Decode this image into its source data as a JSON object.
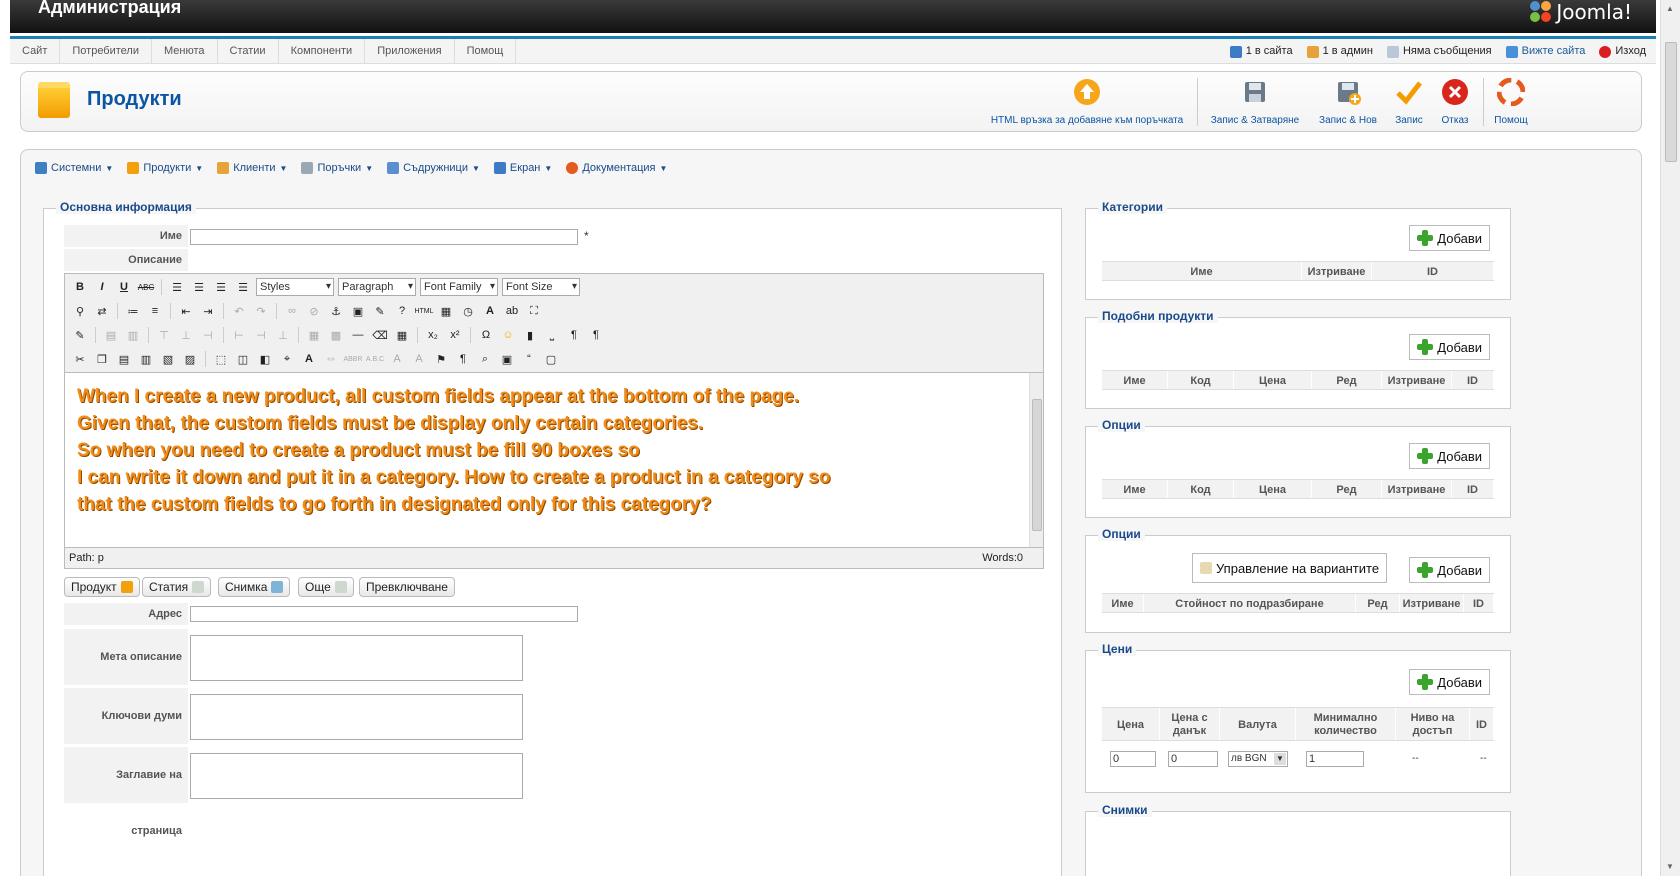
{
  "header": {
    "title": "Администрация",
    "logo": "Joomla!"
  },
  "menu": [
    "Сайт",
    "Потребители",
    "Менюта",
    "Статии",
    "Компоненти",
    "Приложения",
    "Помощ"
  ],
  "status": {
    "site_users": "1 в сайта",
    "admin_users": "1 в админ",
    "messages": "Няма съобщения",
    "view_site": "Вижте сайта",
    "logout": "Изход"
  },
  "toolbar": {
    "page_title": "Продукти",
    "html_link": "HTML връзка за добавяне към поръчката",
    "save_close": "Запис & Затваряне",
    "save_new": "Запис & Нов",
    "save": "Запис",
    "cancel": "Отказ",
    "help": "Помощ"
  },
  "submenu": [
    "Системни",
    "Продукти",
    "Клиенти",
    "Поръчки",
    "Съдружници",
    "Екран",
    "Документация"
  ],
  "main": {
    "legend": "Основна информация",
    "name_label": "Име",
    "description_label": "Описание",
    "required_mark": "*",
    "editor": {
      "styles": "Styles",
      "paragraph": "Paragraph",
      "font_family": "Font Family",
      "font_size": "Font Size",
      "text": "When I create a new product, all custom fields appear at the bottom of the page.\nGiven that, the custom fields must be display only certain categories.\nSo when you need to create a product must be fill 90 boxes so\nI can write it down and put it in a category. How to create a product in a category so\nthat the custom fields to go forth in designated only for this category?",
      "path": "Path: p",
      "words": "Words:0"
    },
    "tabs": [
      "Продукт",
      "Статия",
      "Снимка",
      "Още",
      "Превключване"
    ],
    "address_label": "Адрес",
    "meta_label": "Мета описание",
    "keywords_label": "Ключови думи",
    "page_title_label": "Заглавие на страница"
  },
  "sidebar": {
    "add": "Добави",
    "categories": {
      "title": "Категории",
      "cols": [
        "Име",
        "Изтриване",
        "ID"
      ]
    },
    "related": {
      "title": "Подобни продукти",
      "cols": [
        "Име",
        "Код",
        "Цена",
        "Ред",
        "Изтриване",
        "ID"
      ]
    },
    "options1": {
      "title": "Опции",
      "cols": [
        "Име",
        "Код",
        "Цена",
        "Ред",
        "Изтриване",
        "ID"
      ]
    },
    "options2": {
      "title": "Опции",
      "manage": "Управление на вариантите",
      "cols": [
        "Име",
        "Стойност по подразбиране",
        "Ред",
        "Изтриване",
        "ID"
      ]
    },
    "prices": {
      "title": "Цени",
      "cols": [
        "Цена",
        "Цена с данък",
        "Валута",
        "Минимално количество",
        "Ниво на достъп",
        "ID"
      ],
      "price": "0",
      "price_tax": "0",
      "currency": "лв BGN",
      "min_qty": "1",
      "access": "--",
      "id": "--"
    },
    "images": {
      "title": "Снимки"
    }
  }
}
